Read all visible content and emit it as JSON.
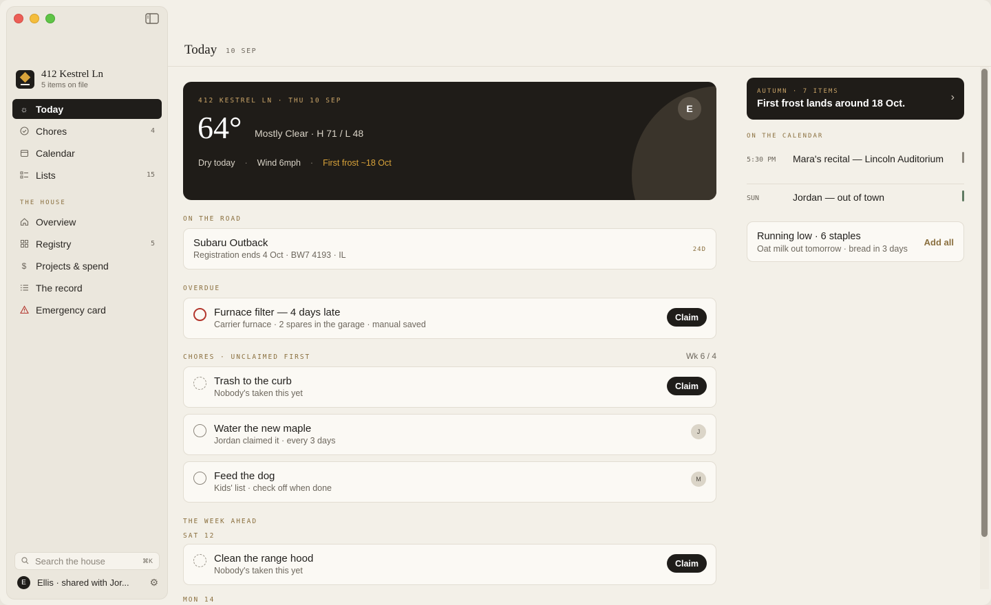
{
  "window": {
    "sidebar_toggle": "sidebar-toggle-icon"
  },
  "house": {
    "name": "412 Kestrel Ln",
    "sub": "5 items on file"
  },
  "nav": [
    {
      "label": "Today",
      "icon": "sun-icon",
      "active": true
    },
    {
      "label": "Chores",
      "icon": "check-circle-icon",
      "count": "4"
    },
    {
      "label": "Calendar",
      "icon": "calendar-icon"
    },
    {
      "label": "Lists",
      "icon": "list-icon",
      "count": "15"
    }
  ],
  "house_section": {
    "label": "THE HOUSE"
  },
  "house_nav": [
    {
      "label": "Overview",
      "icon": "home-icon"
    },
    {
      "label": "Registry",
      "icon": "grid-icon",
      "count": "5"
    },
    {
      "label": "Projects & spend",
      "icon": "dollar-icon"
    },
    {
      "label": "The record",
      "icon": "lines-icon"
    },
    {
      "label": "Emergency card",
      "icon": "warning-icon"
    }
  ],
  "search": {
    "placeholder": "Search the house",
    "shortcut": "⌘K"
  },
  "user": {
    "initial": "E",
    "label": "Ellis · shared with Jor..."
  },
  "header": {
    "title": "Today",
    "date": "10 SEP"
  },
  "weather": {
    "kicker": "412 KESTREL LN · THU 10 SEP",
    "temp": "64°",
    "condition": "Mostly Clear · H 71 / L 48",
    "dry": "Dry today",
    "wind": "Wind 6mph",
    "frost": "First frost ~18 Oct",
    "badge": "E"
  },
  "road": {
    "label": "ON THE ROAD",
    "title": "Subaru Outback",
    "sub": "Registration ends 4 Oct · BW7 4193 · IL",
    "days": "24D"
  },
  "overdue": {
    "label": "OVERDUE",
    "title": "Furnace filter — 4 days late",
    "sub": "Carrier furnace · 2 spares in the garage · manual saved",
    "button": "Claim"
  },
  "chores": {
    "label": "CHORES · UNCLAIMED FIRST",
    "week": "Wk 6 / 4",
    "items": [
      {
        "title": "Trash to the curb",
        "sub": "Nobody's taken this yet",
        "button": "Claim"
      },
      {
        "title": "Water the new maple",
        "sub": "Jordan claimed it · every 3 days",
        "avatar": "J"
      },
      {
        "title": "Feed the dog",
        "sub": "Kids' list · check off when done",
        "avatar": "M"
      }
    ]
  },
  "week": {
    "label": "THE WEEK AHEAD",
    "day1": "SAT 12",
    "item": {
      "title": "Clean the range hood",
      "sub": "Nobody's taken this yet",
      "button": "Claim"
    },
    "day2": "MON 14"
  },
  "season": {
    "kicker": "AUTUMN · 7 ITEMS",
    "message": "First frost lands around 18 Oct."
  },
  "calendar": {
    "label": "ON THE CALENDAR",
    "events": [
      {
        "time": "5:30 PM",
        "title": "Mara's recital — Lincoln Auditorium",
        "color": "#8b857b"
      },
      {
        "time": "SUN",
        "title": "Jordan — out of town",
        "color": "#5f7a62"
      }
    ]
  },
  "staples": {
    "title": "Running low · 6 staples",
    "sub": "Oat milk out tomorrow · bread in 3 days",
    "action": "Add all"
  },
  "colors": {
    "accent": "#8a6f3e",
    "dark": "#1f1c18",
    "overdue": "#b3362d"
  }
}
